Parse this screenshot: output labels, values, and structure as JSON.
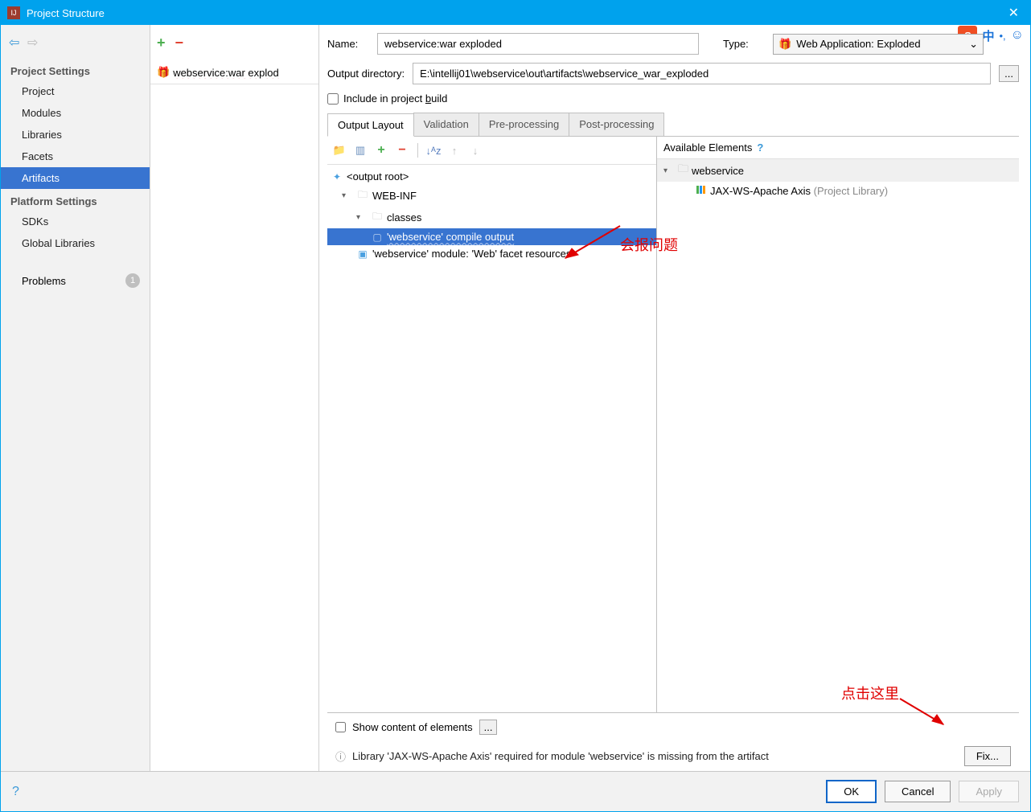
{
  "window": {
    "title": "Project Structure"
  },
  "overlay": {
    "ime_logo": "S",
    "lang": "中"
  },
  "sidebar": {
    "section1": "Project Settings",
    "items1": [
      "Project",
      "Modules",
      "Libraries",
      "Facets",
      "Artifacts"
    ],
    "section2": "Platform Settings",
    "items2": [
      "SDKs",
      "Global Libraries"
    ],
    "problems_label": "Problems",
    "problems_count": "1"
  },
  "artifact_list": {
    "item": "webservice:war explod"
  },
  "form": {
    "name_label": "Name:",
    "name_value": "webservice:war exploded",
    "type_label": "Type:",
    "type_value": "Web Application: Exploded",
    "outdir_label": "Output directory:",
    "outdir_value": "E:\\intellij01\\webservice\\out\\artifacts\\webservice_war_exploded",
    "include_label_pre": "Include in project ",
    "include_label_u": "b",
    "include_label_post": "uild",
    "dots": "..."
  },
  "tabs": [
    "Output Layout",
    "Validation",
    "Pre-processing",
    "Post-processing"
  ],
  "tree": {
    "root": "<output root>",
    "webinf": "WEB-INF",
    "classes": "classes",
    "compile": "'webservice' compile output",
    "facet": "'webservice' module: 'Web' facet resources"
  },
  "avail": {
    "header": "Available Elements",
    "module": "webservice",
    "lib": "JAX-WS-Apache Axis ",
    "lib_suffix": "(Project Library)"
  },
  "footer": {
    "show_label": "Show content of elements",
    "dots": "...",
    "warning": "Library 'JAX-WS-Apache Axis' required for module 'webservice' is missing from the artifact",
    "fix": "Fix..."
  },
  "buttons": {
    "ok": "OK",
    "cancel": "Cancel",
    "apply": "Apply"
  },
  "annotations": {
    "a1": "会报问题",
    "a2": "点击这里"
  }
}
